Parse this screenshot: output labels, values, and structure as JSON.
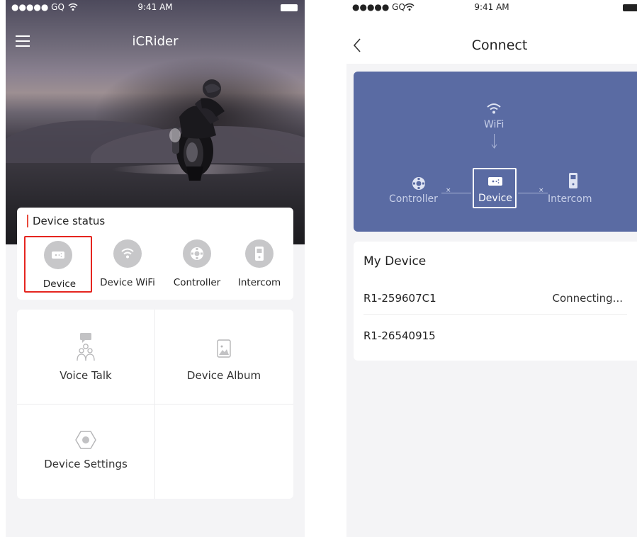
{
  "left_screen": {
    "status_bar": {
      "carrier": "●●●●● GQ",
      "time": "9:41 AM"
    },
    "nav": {
      "title": "iCRider"
    },
    "device_status": {
      "heading": "Device status",
      "items": [
        {
          "label": "Device",
          "icon": "device-icon",
          "selected": true
        },
        {
          "label": "Device WiFi",
          "icon": "wifi-icon",
          "selected": false
        },
        {
          "label": "Controller",
          "icon": "controller-icon",
          "selected": false
        },
        {
          "label": "Intercom",
          "icon": "intercom-icon",
          "selected": false
        }
      ]
    },
    "menu": [
      {
        "label": "Voice Talk",
        "icon": "voice-talk-icon"
      },
      {
        "label": "Device Album",
        "icon": "album-icon"
      },
      {
        "label": "Device Settings",
        "icon": "settings-icon"
      }
    ]
  },
  "right_screen": {
    "status_bar": {
      "carrier": "●●●●● GQ",
      "time": "9:41 AM"
    },
    "nav": {
      "title": "Connect"
    },
    "diagram": {
      "wifi_label": "WiFi",
      "controller_label": "Controller",
      "device_label": "Device",
      "intercom_label": "Intercom",
      "link_mark": "×"
    },
    "my_device": {
      "heading": "My Device",
      "devices": [
        {
          "name": "R1-259607C1",
          "state": "Connecting..."
        },
        {
          "name": "R1-26540915",
          "state": ""
        }
      ]
    }
  },
  "colors": {
    "accent_red": "#e5251f",
    "diagram_bg": "#5a6ba3",
    "icon_gray": "#c7c7c9"
  }
}
